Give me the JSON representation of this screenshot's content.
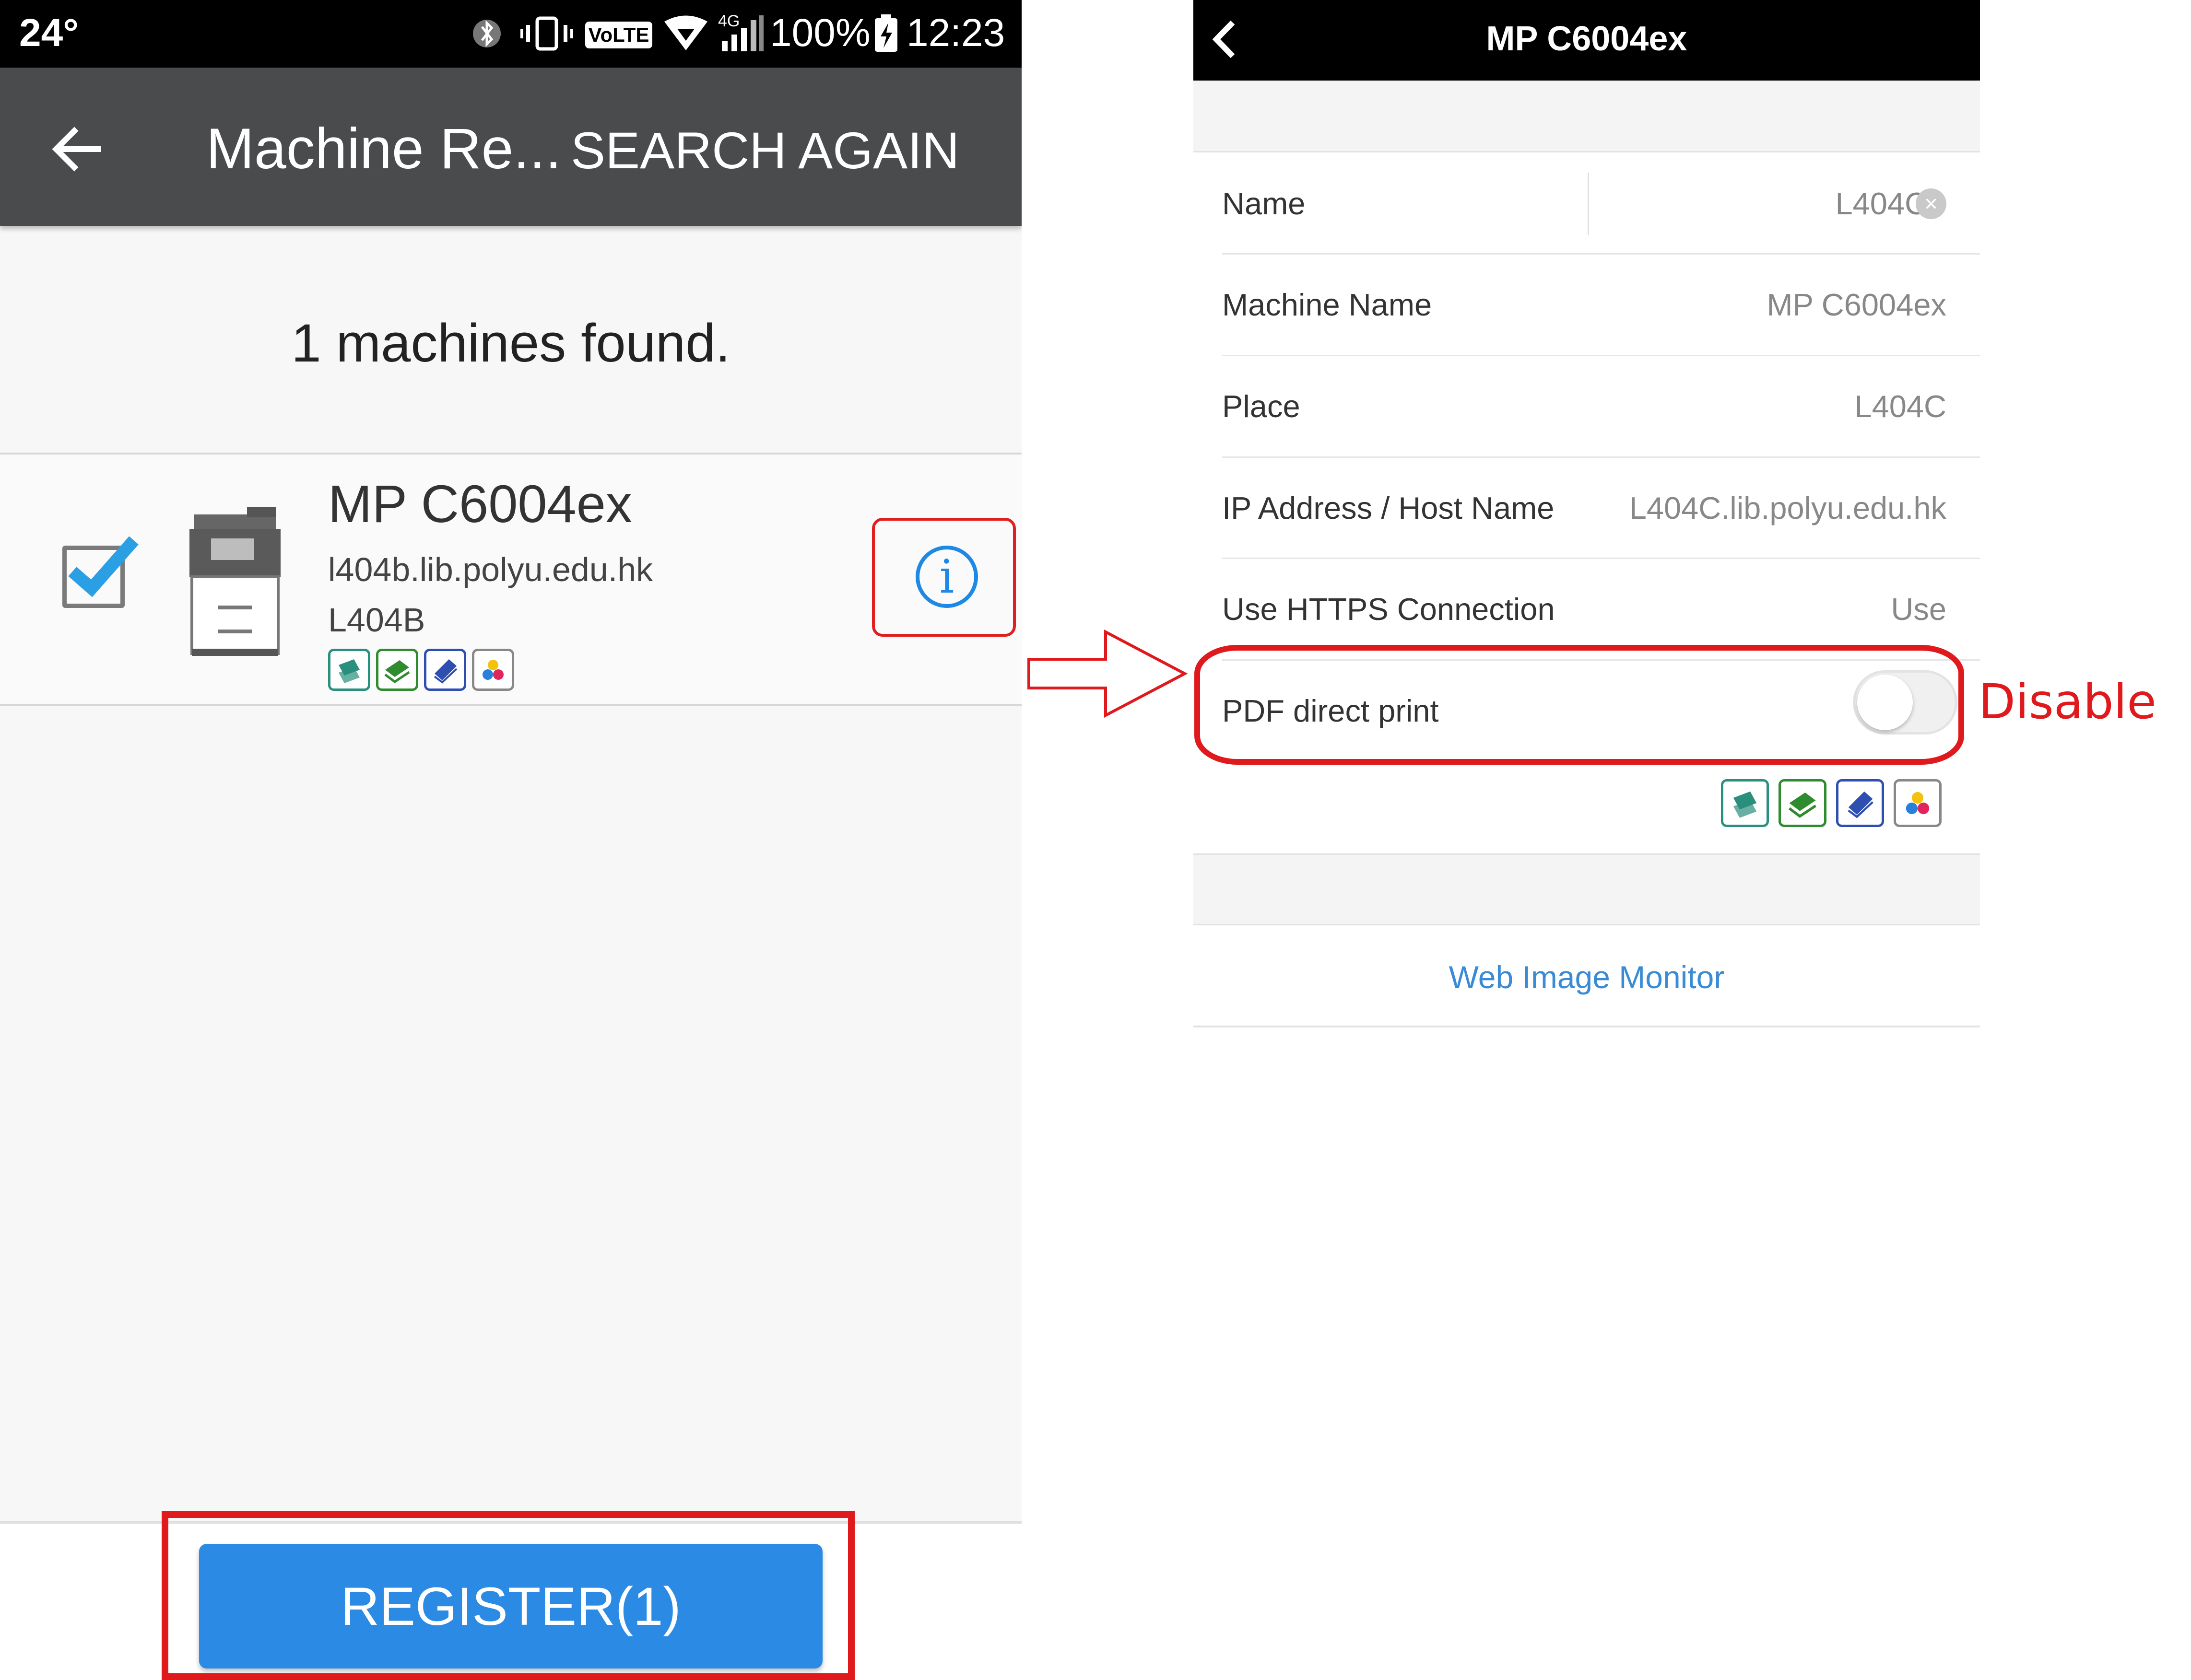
{
  "left_screen": {
    "status_bar": {
      "temperature": "24°",
      "volte": "VoLTE",
      "network": "4G",
      "battery": "100%",
      "time": "12:23"
    },
    "app_bar": {
      "back_icon": "arrow-left-icon",
      "title": "Machine Re...",
      "action": "SEARCH AGAIN"
    },
    "found_text": "1 machines found.",
    "machine": {
      "checked": true,
      "name": "MP C6004ex",
      "host": "l404b.lib.polyu.edu.hk",
      "place": "L404B",
      "function_icons": [
        "copy-icon",
        "scan-icon",
        "print-icon",
        "color-icon"
      ]
    },
    "register_button": "REGISTER(1)"
  },
  "right_screen": {
    "title": "MP C6004ex",
    "rows": [
      {
        "label": "Name",
        "value": "L404C"
      },
      {
        "label": "Machine Name",
        "value": "MP C6004ex"
      },
      {
        "label": "Place",
        "value": "L404C"
      },
      {
        "label": "IP Address / Host Name",
        "value": "L404C.lib.polyu.edu.hk"
      },
      {
        "label": "Use HTTPS Connection",
        "value": "Use"
      }
    ],
    "pdf_direct_print": {
      "label": "PDF direct print",
      "enabled": false
    },
    "function_icons": [
      "copy-icon",
      "scan-icon",
      "print-icon",
      "color-icon"
    ],
    "web_image_monitor": "Web Image Monitor"
  },
  "annotation": {
    "disable_label": "Disable",
    "highlight_color": "#e0191c"
  },
  "colors": {
    "app_bar": "#4a4b4d",
    "primary_button": "#2a8ae4",
    "link": "#3a8bd6",
    "check": "#2a9fe4"
  }
}
